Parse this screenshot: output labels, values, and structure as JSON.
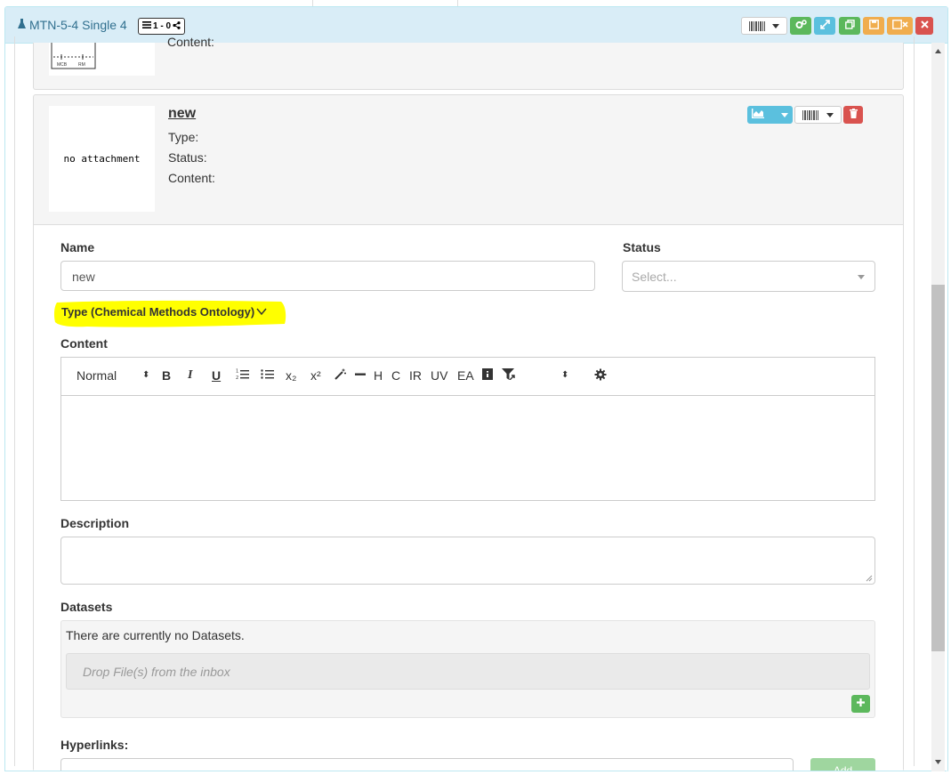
{
  "header": {
    "title": "MTN-5-4 Single 4",
    "badge_text": "1 - 0",
    "colors": {
      "heading_bg": "#d9edf7",
      "title": "#31708f",
      "green": "#5cb85c",
      "info": "#5bc0de",
      "warning": "#f0ad4e",
      "danger": "#d9534f"
    }
  },
  "prev_card": {
    "content_label": "Content:",
    "thumb_labels": [
      "MCB",
      "RM"
    ]
  },
  "analysis": {
    "thumb_text": "no attachment",
    "name": "new",
    "type_label": "Type:",
    "status_label": "Status:",
    "content_label": "Content:"
  },
  "form": {
    "name_label": "Name",
    "name_value": "new",
    "status_label": "Status",
    "status_placeholder": "Select...",
    "type_label": "Type (Chemical Methods Ontology)",
    "content_label": "Content",
    "toolbar": {
      "format": "Normal",
      "bold": "B",
      "italic": "I",
      "underline": "U",
      "subscript": "x₂",
      "superscript": "x²",
      "h": "H",
      "c": "C",
      "ir": "IR",
      "uv": "UV",
      "ea": "EA"
    },
    "description_label": "Description",
    "datasets_label": "Datasets",
    "datasets_empty": "There are currently no Datasets.",
    "drop_text": "Drop File(s) from the inbox",
    "hyperlinks_label": "Hyperlinks:",
    "add_label": "Add"
  },
  "icons": [
    "flask-icon",
    "list-icon",
    "share-icon",
    "barcode-icon",
    "cogs-icon",
    "expand-icon",
    "copy-icon",
    "save-icon",
    "save-close-icon",
    "close-icon",
    "chart-icon",
    "trash-icon",
    "plus-icon",
    "gear-icon",
    "filter-icon",
    "magic-icon"
  ]
}
